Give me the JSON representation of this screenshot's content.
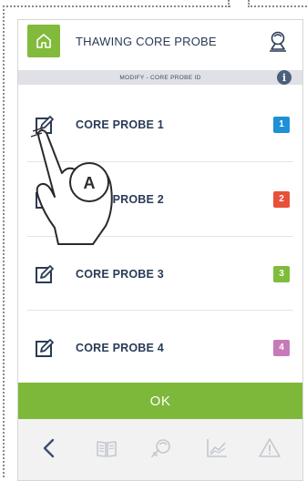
{
  "header": {
    "title": "THAWING CORE PROBE",
    "icons": {
      "home": "home-icon",
      "probe": "probe-connection-icon"
    }
  },
  "subheader": {
    "text": "MODIFY - CORE PROBE ID",
    "info_icon": "info-icon",
    "info_glyph": "i"
  },
  "probes": [
    {
      "label": "CORE PROBE 1",
      "number": "1",
      "color": "#1e90d6"
    },
    {
      "label": "CORE PROBE 2",
      "number": "2",
      "color": "#e8503a"
    },
    {
      "label": "CORE PROBE 3",
      "number": "3",
      "color": "#7fbc3a"
    },
    {
      "label": "CORE PROBE 4",
      "number": "4",
      "color": "#c77ab8"
    }
  ],
  "ok_label": "OK",
  "footer": {
    "icons": [
      "back-icon",
      "book-icon",
      "probe-chef-icon",
      "chart-icon",
      "warning-icon"
    ]
  },
  "annotation": {
    "callout": "A"
  },
  "colors": {
    "accent": "#7db83a",
    "text": "#2a3b57"
  }
}
